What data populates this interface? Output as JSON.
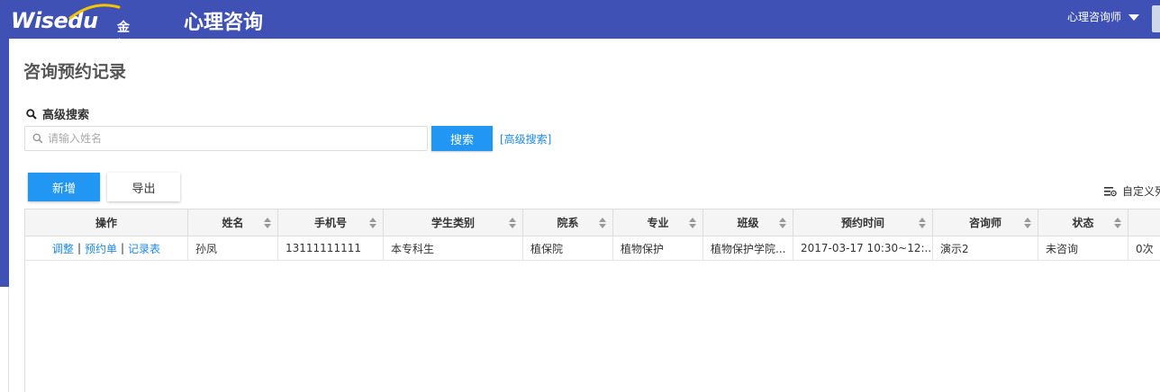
{
  "header": {
    "logo_word": "Wisedu",
    "logo_cn": "金智教育",
    "app_title": "心理咨询",
    "role": "心理咨询师"
  },
  "page": {
    "title": "咨询预约记录",
    "adv_search_label": "高级搜索",
    "search_placeholder": "请输入姓名",
    "search_button": "搜索",
    "adv_search_link": "[高级搜索]",
    "add_button": "新增",
    "export_button": "导出",
    "custom_columns": "自定义列"
  },
  "table": {
    "columns": [
      "操作",
      "姓名",
      "手机号",
      "学生类别",
      "院系",
      "专业",
      "班级",
      "预约时间",
      "咨询师",
      "状态",
      ""
    ],
    "rows": [
      {
        "ops": [
          "调整",
          "预约单",
          "记录表"
        ],
        "name": "孙凤",
        "phone": "13111111111",
        "category": "本专科生",
        "dept": "植保院",
        "major": "植物保护",
        "class": "植物保护学院...",
        "time": "2017-03-17 10:30~12:...",
        "counselor": "演示2",
        "status": "未咨询",
        "count": "0次"
      }
    ]
  }
}
